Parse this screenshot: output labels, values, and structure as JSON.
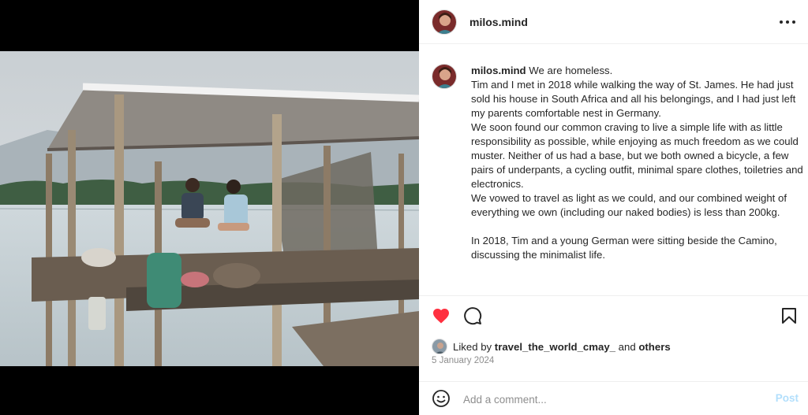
{
  "post": {
    "username": "milos.mind",
    "more_icon": "more-horizontal-icon",
    "caption": {
      "username": "milos.mind",
      "first_line": "We are homeless.",
      "paragraphs": [
        "Tim and I met in 2018 while walking the way of St. James. He had just sold his house in South Africa and all his belongings, and I had just left my parents comfortable nest in Germany.",
        "We soon found our common craving to live a simple life with as little responsibility as possible, while enjoying as much freedom as we could muster. Neither of us had a base, but we both owned a bicycle, a few pairs of underpants, a cycling outfit, minimal spare clothes, toiletries and electronics.",
        "We vowed to travel as light as we could, and our combined weight of everything we own (including our naked bodies) is less than 200kg.",
        "",
        "In 2018, Tim and a young German were sitting beside the Camino, discussing the minimalist life."
      ]
    },
    "actions": {
      "like_icon": "heart-filled-icon",
      "comment_icon": "comment-icon",
      "save_icon": "bookmark-icon",
      "like_color": "#ff3040"
    },
    "likes": {
      "prefix": "Liked by",
      "user": "travel_the_world_cmay_",
      "joiner": "and",
      "others": "others"
    },
    "date": "5 January 2024",
    "comment": {
      "emoji_icon": "emoji-smile-icon",
      "placeholder": "Add a comment...",
      "post_label": "Post",
      "post_color": "#b2dffc"
    }
  }
}
